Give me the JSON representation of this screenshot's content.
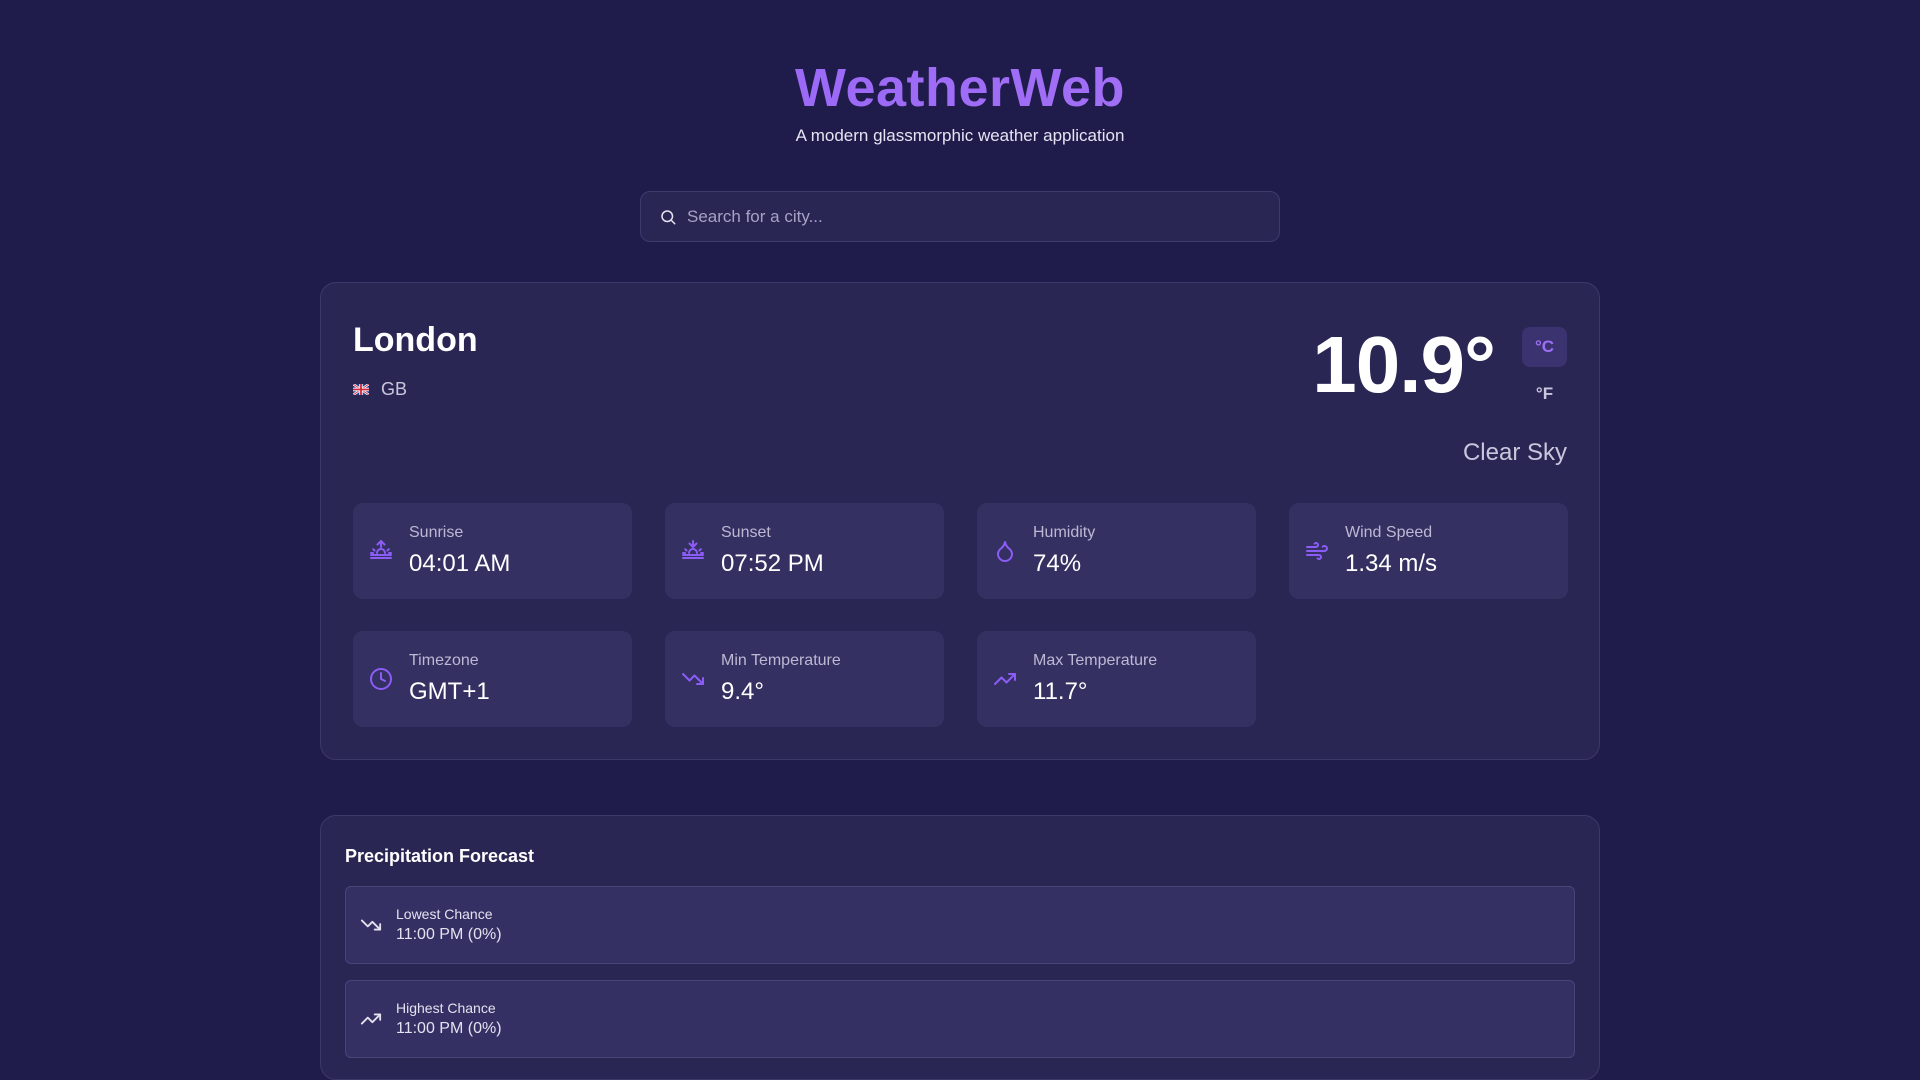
{
  "app": {
    "title": "WeatherWeb",
    "subtitle": "A modern glassmorphic weather application"
  },
  "search": {
    "placeholder": "Search for a city...",
    "value": ""
  },
  "weather": {
    "city": "London",
    "country_code": "GB",
    "temperature": "10.9°",
    "unit_celsius": "°C",
    "unit_fahrenheit": "°F",
    "selected_unit": "°C",
    "condition": "Clear Sky",
    "stats": [
      {
        "label": "Sunrise",
        "value": "04:01 AM",
        "icon": "sunrise-icon"
      },
      {
        "label": "Sunset",
        "value": "07:52 PM",
        "icon": "sunset-icon"
      },
      {
        "label": "Humidity",
        "value": "74%",
        "icon": "droplet-icon"
      },
      {
        "label": "Wind Speed",
        "value": "1.34 m/s",
        "icon": "wind-icon"
      },
      {
        "label": "Timezone",
        "value": "GMT+1",
        "icon": "clock-icon"
      },
      {
        "label": "Min Temperature",
        "value": "9.4°",
        "icon": "trending-down-icon"
      },
      {
        "label": "Max Temperature",
        "value": "11.7°",
        "icon": "trending-up-icon"
      }
    ]
  },
  "precipitation": {
    "title": "Precipitation Forecast",
    "rows": [
      {
        "label": "Lowest Chance",
        "value": "11:00 PM (0%)",
        "icon": "trending-down-icon"
      },
      {
        "label": "Highest Chance",
        "value": "11:00 PM (0%)",
        "icon": "trending-up-icon"
      }
    ]
  },
  "colors": {
    "background": "#1f1b4b",
    "card": "#2a2654",
    "accent": "#8b5cf6",
    "tile": "#343062"
  }
}
